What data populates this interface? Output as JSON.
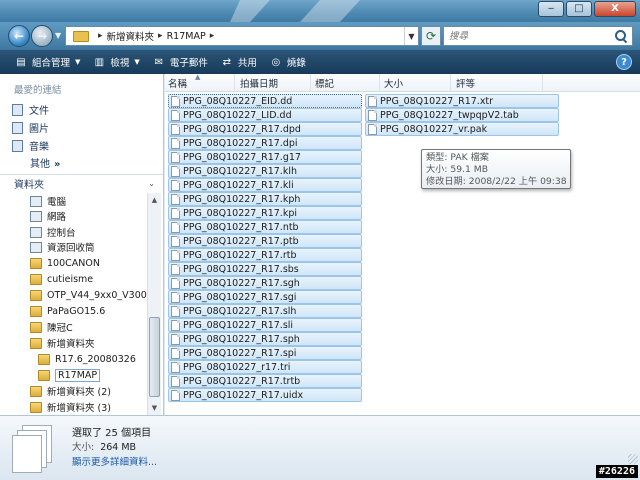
{
  "window": {
    "buttons": {
      "minimize": "‒",
      "maximize": "□",
      "close": "X"
    }
  },
  "address": {
    "crumbs": [
      "新增資料夾",
      "R17MAP"
    ],
    "search_placeholder": "搜尋"
  },
  "toolbar": {
    "organize": "組合管理",
    "views": "檢視",
    "email": "電子郵件",
    "share": "共用",
    "burn": "燒錄",
    "help": "?"
  },
  "nav": {
    "favorites_heading": "最愛的連結",
    "favorites": [
      "文件",
      "圖片",
      "音樂"
    ],
    "more": "其他",
    "more_arrow": "»",
    "folders_label": "資料夾",
    "tree": [
      {
        "label": "電腦",
        "icon": "computer-icon"
      },
      {
        "label": "網路",
        "icon": "network-icon"
      },
      {
        "label": "控制台",
        "icon": "control-panel-icon"
      },
      {
        "label": "資源回收筒",
        "icon": "recycle-bin-icon"
      },
      {
        "label": "100CANON",
        "icon": "folder-icon"
      },
      {
        "label": "cutieisme",
        "icon": "folder-icon"
      },
      {
        "label": "OTP_V44_9xx0_V300",
        "icon": "folder-icon"
      },
      {
        "label": "PaPaGO15.6",
        "icon": "folder-icon"
      },
      {
        "label": "陳冠C",
        "icon": "folder-icon"
      },
      {
        "label": "新增資料夾",
        "icon": "folder-icon"
      },
      {
        "label": "R17.6_20080326",
        "icon": "folder-icon"
      },
      {
        "label": "R17MAP",
        "icon": "folder-icon"
      },
      {
        "label": "新增資料夾 (2)",
        "icon": "folder-icon"
      },
      {
        "label": "新增資料夾 (3)",
        "icon": "folder-icon"
      }
    ]
  },
  "columns": [
    "名稱",
    "拍攝日期",
    "標記",
    "大小",
    "評等"
  ],
  "files_col1": [
    "PPG_08Q10227_EID.dd",
    "PPG_08Q10227_LID.dd",
    "PPG_08Q10227_R17.dpd",
    "PPG_08Q10227_R17.dpi",
    "PPG_08Q10227_R17.g17",
    "PPG_08Q10227_R17.klh",
    "PPG_08Q10227_R17.kli",
    "PPG_08Q10227_R17.kph",
    "PPG_08Q10227_R17.kpi",
    "PPG_08Q10227_R17.ntb",
    "PPG_08Q10227_R17.ptb",
    "PPG_08Q10227_R17.rtb",
    "PPG_08Q10227_R17.sbs",
    "PPG_08Q10227_R17.sgh",
    "PPG_08Q10227_R17.sgi",
    "PPG_08Q10227_R17.slh",
    "PPG_08Q10227_R17.sli",
    "PPG_08Q10227_R17.sph",
    "PPG_08Q10227_R17.spi",
    "PPG_08Q10227_r17.tri",
    "PPG_08Q10227_R17.trtb",
    "PPG_08Q10227_R17.uidx"
  ],
  "files_col2": [
    "PPG_08Q10227_R17.xtr",
    "PPG_08Q10227_twpqpV2.tab",
    "PPG_08Q10227_vr.pak"
  ],
  "tooltip": {
    "type": "類型: PAK 檔案",
    "size": "大小: 59.1 MB",
    "modified": "修改日期: 2008/2/22 上午 09:38"
  },
  "details": {
    "selected": "選取了 25 個項目",
    "size_label": "大小:",
    "size_value": "264 MB",
    "more_link": "顯示更多詳細資料..."
  },
  "watermark": "#26226"
}
